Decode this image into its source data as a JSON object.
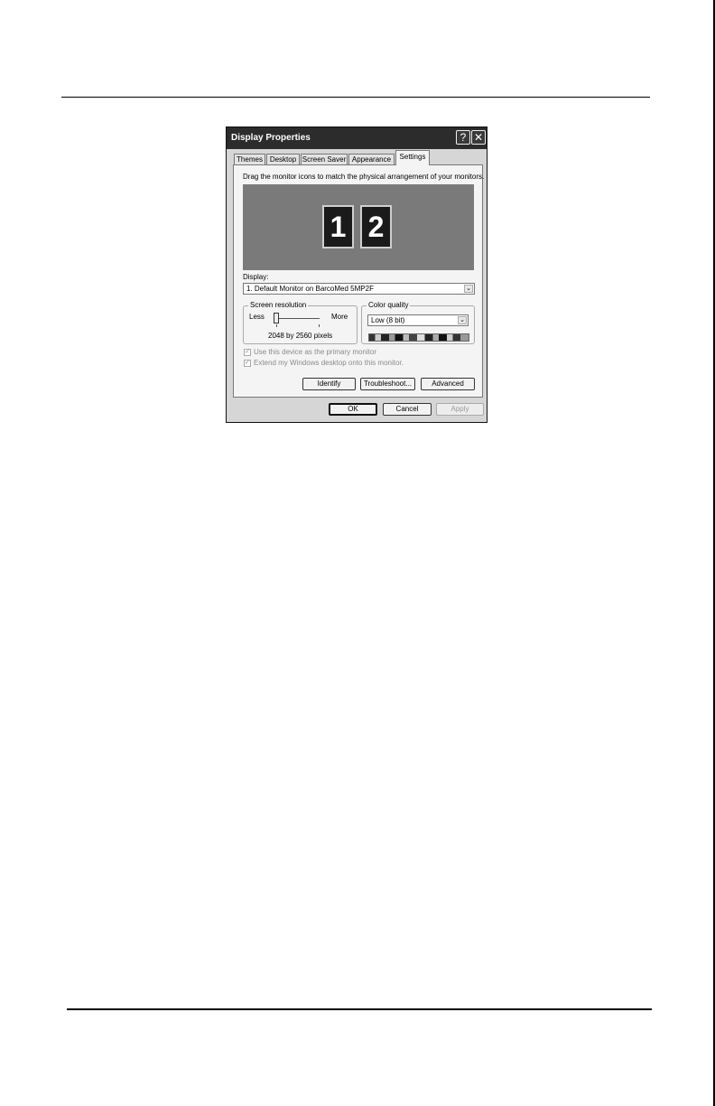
{
  "window": {
    "title": "Display Properties",
    "help_glyph": "?",
    "close_glyph": "✕"
  },
  "tabs": [
    {
      "label": "Themes"
    },
    {
      "label": "Desktop"
    },
    {
      "label": "Screen Saver"
    },
    {
      "label": "Appearance"
    },
    {
      "label": "Settings",
      "active": true
    }
  ],
  "settings": {
    "instruction": "Drag the monitor icons to match the physical arrangement of your monitors.",
    "monitors": [
      {
        "label": "1"
      },
      {
        "label": "2"
      }
    ],
    "display_label": "Display:",
    "display_value": "1. Default Monitor on BarcoMed 5MP2F",
    "screen_resolution": {
      "legend": "Screen resolution",
      "less": "Less",
      "more": "More",
      "slider_level": 0,
      "value_text": "2048 by 2560 pixels"
    },
    "color_quality": {
      "legend": "Color quality",
      "value": "Low (8 bit)"
    },
    "checkboxes": [
      {
        "label": "Use this device as the primary monitor",
        "checked": true,
        "enabled": false
      },
      {
        "label": "Extend my Windows desktop onto this monitor.",
        "checked": true,
        "enabled": false
      }
    ],
    "buttons": {
      "identify": "Identify",
      "troubleshoot": "Troubleshoot...",
      "advanced": "Advanced"
    }
  },
  "footer_buttons": {
    "ok": "OK",
    "cancel": "Cancel",
    "apply": "Apply"
  },
  "glyphs": {
    "dropdown_arrow": "⌄",
    "check": "✓"
  }
}
